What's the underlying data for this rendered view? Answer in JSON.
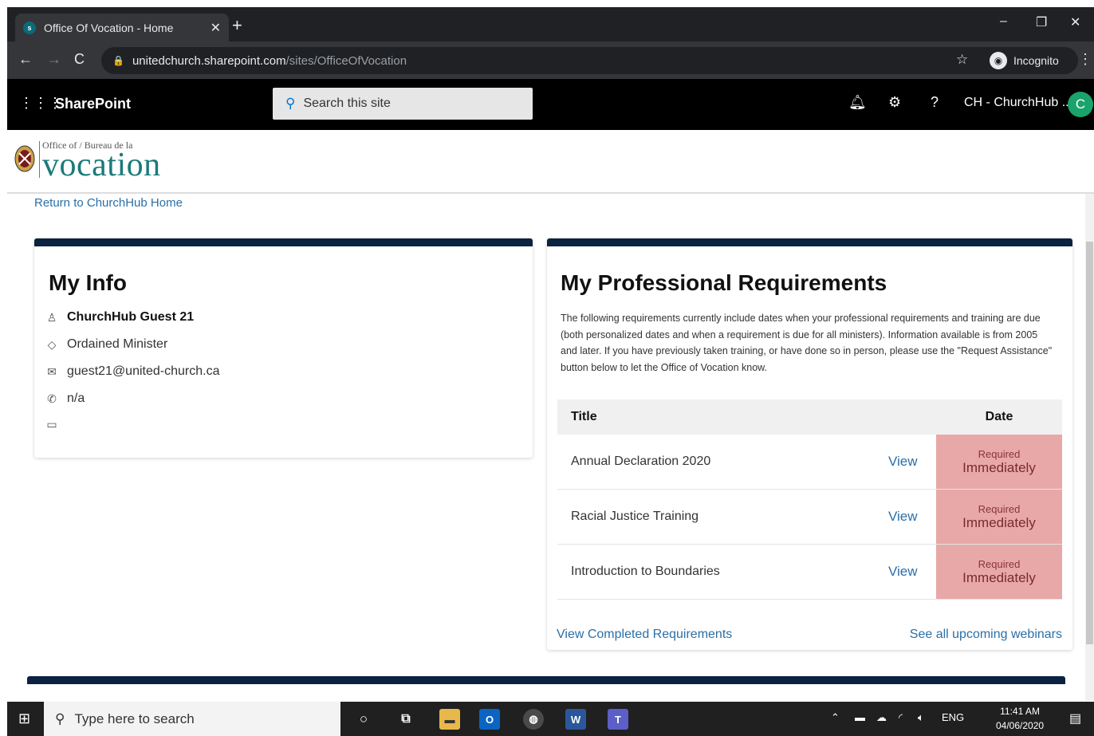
{
  "browser": {
    "tab_title": "Office Of Vocation - Home",
    "tab_favicon_text": "s",
    "url_host": "unitedchurch.sharepoint.com",
    "url_path": "/sites/OfficeOfVocation",
    "incognito_label": "Incognito"
  },
  "suitebar": {
    "brand": "SharePoint",
    "search_placeholder": "Search this site",
    "user_label": "CH - ChurchHub ..",
    "avatar_initial": "C"
  },
  "site": {
    "logo_small": "Office of / Bureau de la",
    "logo_big": "vocation",
    "return_link": "Return to ChurchHub Home"
  },
  "my_info": {
    "title": "My Info",
    "name": "ChurchHub Guest 21",
    "role": "Ordained Minister",
    "email": "guest21@united-church.ca",
    "phone": "n/a"
  },
  "requirements": {
    "title": "My Professional Requirements",
    "description": "The following requirements currently include dates when your professional requirements and training are due (both personalized dates and when a requirement is due for all ministers). Information available is from 2005 and later. If you have previously taken training, or have done so in person, please use the \"Request Assistance\" button below to let the Office of Vocation know.",
    "col_title": "Title",
    "col_date": "Date",
    "rows": [
      {
        "title": "Annual Declaration 2020",
        "view": "View",
        "status_small": "Required",
        "status_big": "Immediately"
      },
      {
        "title": "Racial Justice Training",
        "view": "View",
        "status_small": "Required",
        "status_big": "Immediately"
      },
      {
        "title": "Introduction to Boundaries",
        "view": "View",
        "status_small": "Required",
        "status_big": "Immediately"
      }
    ],
    "link_completed": "View Completed Requirements",
    "link_webinars": "See all upcoming webinars"
  },
  "taskbar": {
    "search_placeholder": "Type here to search",
    "lang": "ENG",
    "time": "11:41 AM",
    "date": "04/06/2020"
  },
  "colors": {
    "card_accent": "#0b2240",
    "link": "#2a6fa8",
    "required_bg": "#e8a8a8",
    "logo_teal": "#1a7a7a"
  }
}
